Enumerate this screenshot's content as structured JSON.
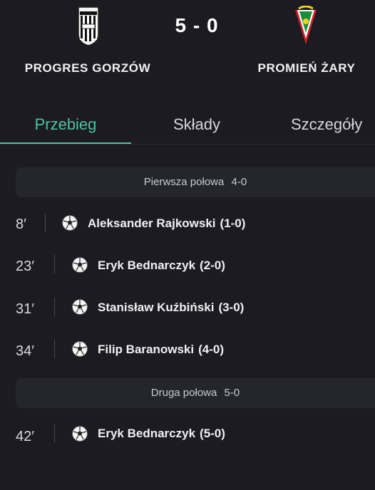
{
  "match": {
    "home_team": "PROGRES GORZÓW",
    "away_team": "PROMIEŃ ŻARY",
    "score": "5 - 0",
    "home_crest_icon": "progres-gorzow-crest-icon",
    "away_crest_icon": "promien-zary-crest-icon"
  },
  "tabs": [
    {
      "label": "Przebieg",
      "active": true
    },
    {
      "label": "Składy",
      "active": false
    },
    {
      "label": "Szczegóły",
      "active": false
    }
  ],
  "sections": [
    {
      "label": "Pierwsza połowa",
      "score": "4-0"
    },
    {
      "label": "Druga połowa",
      "score": "5-0"
    }
  ],
  "events": [
    {
      "minute": "8′",
      "player": "Aleksander Rajkowski",
      "result": "(1-0)",
      "icon": "soccer-ball-icon"
    },
    {
      "minute": "23′",
      "player": "Eryk Bednarczyk",
      "result": "(2-0)",
      "icon": "soccer-ball-icon"
    },
    {
      "minute": "31′",
      "player": "Stanisław Kuźbiński",
      "result": "(3-0)",
      "icon": "soccer-ball-icon"
    },
    {
      "minute": "34′",
      "player": "Filip Baranowski",
      "result": "(4-0)",
      "icon": "soccer-ball-icon"
    },
    {
      "minute": "42′",
      "player": "Eryk Bednarczyk",
      "result": "(5-0)",
      "icon": "soccer-ball-icon"
    }
  ],
  "colors": {
    "background": "#1b1b21",
    "accent": "#4fc3a1",
    "section_bg": "#25252d"
  }
}
